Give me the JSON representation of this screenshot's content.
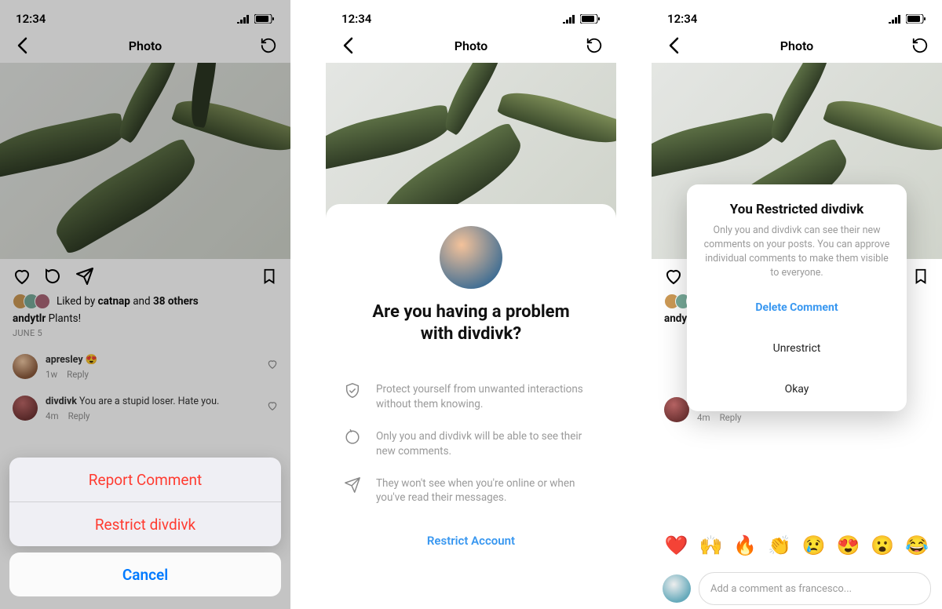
{
  "status": {
    "time": "12:34"
  },
  "nav": {
    "title": "Photo"
  },
  "post": {
    "likes_prefix": "Liked by ",
    "likes_highlight": "catnap",
    "likes_middle": " and ",
    "likes_others": "38 others",
    "caption_user": "andytlr",
    "caption_text": " Plants!",
    "date": "JUNE 5"
  },
  "comments": [
    {
      "user": "apresley",
      "text": " 😍",
      "age": "1w",
      "reply": "Reply"
    },
    {
      "user": "divdivk",
      "text": " You are a stupid loser. Hate you.",
      "age": "4m",
      "reply": "Reply"
    }
  ],
  "sheet1": {
    "report": "Report Comment",
    "restrict": "Restrict divdivk",
    "cancel": "Cancel"
  },
  "sheet2": {
    "title_l1": "Are you having a problem",
    "title_l2": "with divdivk?",
    "f1": "Protect yourself from unwanted interactions without them knowing.",
    "f2": "Only you and divdivk will be able to see their new comments.",
    "f3": "They won't see when you're online or when you've read their messages.",
    "cta": "Restrict Account"
  },
  "modal": {
    "title": "You Restricted divdivk",
    "body": "Only you and divdivk can see their new comments on your posts. You can approve individual comments to make them visible to everyone.",
    "delete": "Delete Comment",
    "unrestrict": "Unrestrict",
    "okay": "Okay"
  },
  "emojis": [
    "❤️",
    "🙌",
    "🔥",
    "👏",
    "😢",
    "😍",
    "😮",
    "😂"
  ],
  "input": {
    "placeholder": "Add a comment as francesco..."
  }
}
